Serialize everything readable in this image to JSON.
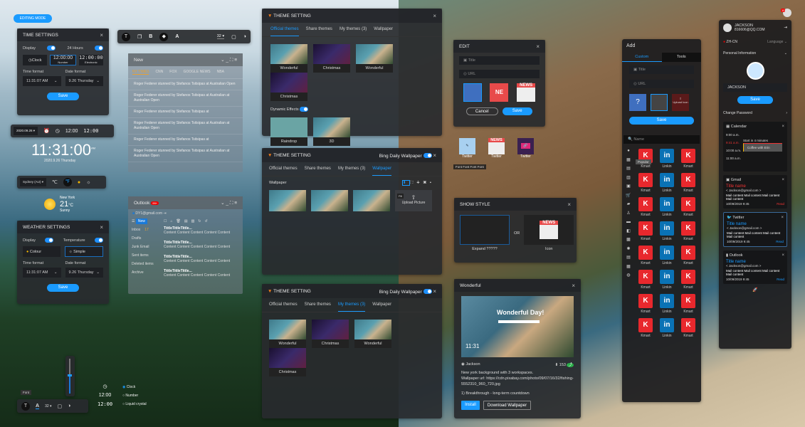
{
  "editing_mode": "EDITING MODE",
  "time_settings": {
    "title": "TIME SETTINGS",
    "display": "Display",
    "hours24": "24 Hours",
    "styles": [
      "Clock",
      "12:00:00",
      "Number",
      "12:00:00",
      "Electronic"
    ],
    "time_format_label": "Time format",
    "time_format": "11:31:07 AM",
    "date_format_label": "Date format",
    "date_format": "9.26 Thursday",
    "save": "Save"
  },
  "text_toolbar": {
    "bold": "B",
    "a": "A",
    "size": "32"
  },
  "news": {
    "title": "New",
    "tabs": [
      "NY TIMES",
      "CNN",
      "FOX",
      "GOOGLE NEWS",
      "NBA"
    ],
    "items": [
      "Roger Federer stunned by Stefanos Tsitsipas at Australian Open",
      "Roger Federer stunned by Stefanos Tsitsipas at Australian at Australian Open",
      "Roger Federer stunned by Stefanos Tsitsipas at",
      "Roger Federer stunned by Stefanos Tsitsipas at Australian at Australian Open",
      "Roger Federer stunned by Stefanos Tsitsipas at",
      "Roger Federer stunned by Stefanos Tsitsipas at Australian at Australian Open"
    ]
  },
  "date_bar": {
    "date": "2020.09.26",
    "clock1": "12:00",
    "clock2": "12:00"
  },
  "big_clock": {
    "time": "11:31:00",
    "ampm": "AM",
    "date": "2020.9.26  Thursday"
  },
  "weather_bar": {
    "city": "Sydney (AU)",
    "c": "℃",
    "f": "℉"
  },
  "weather": {
    "city": "New York",
    "temp": "21",
    "unit": "°C",
    "cond": "Sunny"
  },
  "weather_settings": {
    "title": "WEATHER SETTINGS",
    "display": "Display",
    "temperature": "Temperature",
    "colour": "Colour",
    "simple": "Simple",
    "time_format_label": "Time format",
    "time_format": "11:31:07 AM",
    "date_format_label": "Date format",
    "date_format": "9.26 Thursday",
    "save": "Save"
  },
  "outlook": {
    "title": "Outlook",
    "badge": "99+",
    "email": "DY1@gmail.com",
    "new": "New",
    "folders": [
      "Inbox",
      "Drafts",
      "Junk Email",
      "Sent items",
      "Deleted items",
      "Archive"
    ],
    "inbox_count": "17",
    "mails": [
      {
        "t": "TittleTittleTittle...",
        "c": "Content Content Content Content Content"
      },
      {
        "t": "TittleTittleTittle...",
        "c": "Content Content Content Content Content"
      },
      {
        "t": "TittleTittleTittle...",
        "c": "Content Content Content Content Content"
      },
      {
        "t": "TittleTittleTittle...",
        "c": "Content Content Content Content Content"
      }
    ]
  },
  "font_toolbar": {
    "tooltip": "Font",
    "a": "A",
    "size": "32",
    "slider_value": 0.5
  },
  "clock_style": {
    "clock": "12:00",
    "lcd": "12:00",
    "options": [
      "Clock",
      "Number",
      "Liquid crystal"
    ],
    "selected": 0
  },
  "theme1": {
    "title": "THEME SETTING",
    "tabs": [
      "Official themes",
      "Share themes",
      "My themes (3)",
      "Wallpaper"
    ],
    "active": 0,
    "themes": [
      "Wonderful",
      "Christmas",
      "Wonderful",
      "Christmas"
    ],
    "dynamic": "Dynamic Effects",
    "effects": [
      "Raindrop",
      "3D"
    ]
  },
  "theme2": {
    "title": "THEME SETTING",
    "bing": "Bing Daily Wallpaper",
    "tabs": [
      "Official themes",
      "Share themes",
      "My themes (3)",
      "Wallpaper"
    ],
    "active": 3,
    "section": "Wallpaper",
    "fill_tip": "Fill",
    "upload": "Upload Picture"
  },
  "theme3": {
    "title": "THEME SETTING",
    "bing": "Bing Daily Wallpaper",
    "tabs": [
      "Official themes",
      "Share themes",
      "My themes (3)",
      "Wallpaper"
    ],
    "active": 2,
    "themes": [
      "Wonderful",
      "Christmas",
      "Wonderful",
      "Christmas"
    ]
  },
  "edit": {
    "title": "EDIT",
    "title_ph": "Title",
    "url_ph": "URL",
    "ne": "NE",
    "news": "NEWS",
    "cancel": "Cancel",
    "save": "Save"
  },
  "desk_icons": {
    "items": [
      "Twitter",
      "Twitter",
      "Twitter"
    ],
    "tooltip": "Font Font Font Font",
    "news": "NEWS"
  },
  "show_style": {
    "title": "SHOW STYLE",
    "or": "OR",
    "expand": "Expand ?????",
    "icon": "Icon",
    "news": "NEWS"
  },
  "wonderful": {
    "title": "Wonderful",
    "preview": "Wonderful Day!",
    "clock": "11:31",
    "author": "Jackson",
    "downloads": "153",
    "desc": "New york background with 3 workspaces.",
    "url": "Wallpaper url: https://cdn.pixabay.com/photo/09/07/16/32/fishing-5552310_960_720.jpg",
    "note": "1) Breakthrough - long-term countdown",
    "install": "Install",
    "download": "Download Wallpaper"
  },
  "add": {
    "title": "Add",
    "tabs": [
      "Custom",
      "Tools"
    ],
    "title_ph": "Title",
    "url_ph": "URL",
    "upload": "Upload Icon",
    "save": "Save",
    "search_ph": "Name",
    "popular": "Popular",
    "apps": [
      "Kmart",
      "Linkin",
      "Kmart"
    ],
    "rows": 8
  },
  "account": {
    "badge": "10",
    "name": "JACKSON",
    "email": "816606@QQ.COM",
    "lang": "ZH-CN",
    "lang_label": "Language",
    "personal": "Personal Information",
    "name_value": "JACKSON",
    "save": "Save",
    "change_pw": "Change Password",
    "calendar": {
      "title": "Calendar",
      "times": [
        "9:00 a.m.",
        "9:41 a.m.",
        "10:00 a.m.",
        "11:00 a.m."
      ],
      "start": "Start in 4 minutes",
      "event": "Coffee with Erin"
    },
    "gmail": {
      "title": "Gmail",
      "name": "Title name",
      "from": "< Jackson@gmail.com >",
      "content": "Mail content Mail content Mail content Mail content",
      "date": "10/09/2019 9:45",
      "read": "Read"
    },
    "twitter": {
      "title": "Twitter",
      "name": "Title name",
      "from": "< Jackson@gmail.com >",
      "content": "Mail content Mail content Mail content Mail content",
      "date": "10/09/2019 9:45",
      "read": "Read"
    },
    "outlook": {
      "title": "Outlook",
      "name": "Title name",
      "from": "< Jackson@gmail.com >",
      "content": "Mail content Mail content Mail content Mail content",
      "date": "10/09/2019 9:45",
      "read": "Read"
    }
  },
  "colors": {
    "accent": "#1a9bff",
    "kmart": "#e8282d",
    "linkedin": "#0a72b5",
    "news": "#e84a4a"
  }
}
